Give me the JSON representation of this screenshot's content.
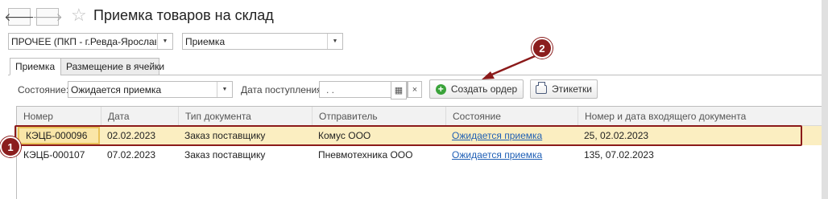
{
  "window": {
    "title": "Приемка товаров на склад",
    "back_icon": "arrow-left",
    "forward_icon": "arrow-right",
    "favorite_icon": "star"
  },
  "selectors": {
    "organization_value": "ПРОЧЕЕ (ПКП - г.Ревда-Ярославск",
    "operation_value": "Приемка"
  },
  "tabs": [
    {
      "label": "Приемка",
      "active": true
    },
    {
      "label": "Размещение в ячейки",
      "active": false
    }
  ],
  "filters": {
    "state_label": "Состояние:",
    "state_value": "Ожидается приемка",
    "date_label": "Дата поступления:",
    "date_value": " .  .",
    "clear_symbol": "×"
  },
  "toolbar": {
    "create_order_label": "Создать ордер",
    "labels_label": "Этикетки"
  },
  "table": {
    "columns": [
      "Номер",
      "Дата",
      "Тип документа",
      "Отправитель",
      "Состояние",
      "Номер и дата входящего документа"
    ],
    "rows": [
      {
        "number": "КЭЦБ-000096",
        "date": "02.02.2023",
        "doc_type": "Заказ поставщику",
        "sender": "Комус ООО",
        "state": "Ожидается приемка",
        "incoming": "25, 02.02.2023"
      },
      {
        "number": "КЭЦБ-000107",
        "date": "07.02.2023",
        "doc_type": "Заказ поставщику",
        "sender": "Пневмотехника ООО",
        "state": "Ожидается приемка",
        "incoming": "135, 07.02.2023"
      }
    ]
  },
  "annotations": {
    "badge_1": "1",
    "badge_2": "2",
    "color": "#8b1a1a"
  }
}
